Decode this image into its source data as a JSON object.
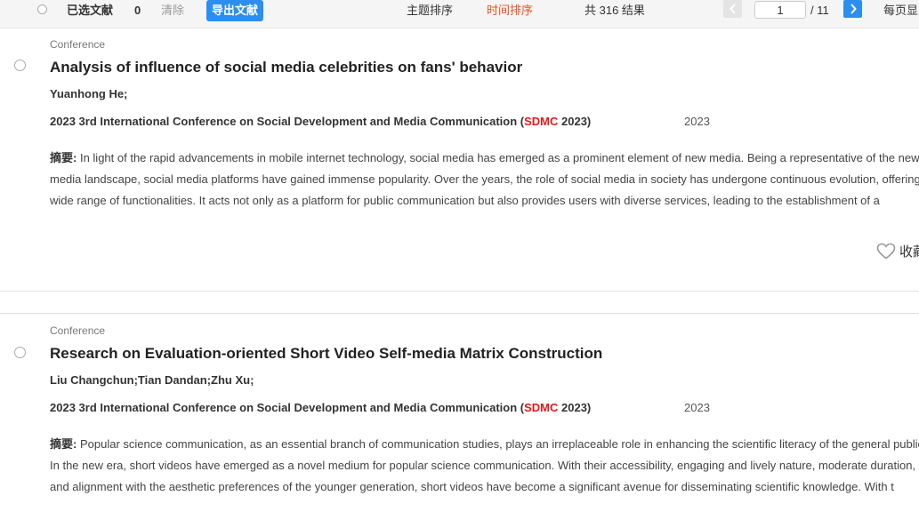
{
  "toolbar": {
    "selected_label": "已选文献",
    "selected_count": "0",
    "clear_label": "清除",
    "export_label": "导出文献",
    "sort_topic": "主题排序",
    "sort_time": "时间排序",
    "result_count": "共 316 结果",
    "page_current": "1",
    "page_total": "/ 11",
    "per_page_label": "每页显"
  },
  "results": [
    {
      "type": "Conference",
      "title": "Analysis of influence of social media celebrities on fans' behavior",
      "authors": "Yuanhong He;",
      "source_before": "2023 3rd International Conference on Social Development and Media Communication (",
      "source_highlight": "SDMC",
      "source_after": " 2023)",
      "year": "2023",
      "abstract_label": "摘要:",
      "abstract": "In light of the rapid advancements in mobile internet technology, social media has emerged as a prominent element of new media. Being a representative of the new media landscape, social media platforms have gained immense popularity. Over the years, the role of social media in society has undergone continuous evolution, offering a wide range of functionalities. It acts not only as a platform for public communication but also provides users with diverse services, leading to the establishment of a",
      "favorite_label": "收藏"
    },
    {
      "type": "Conference",
      "title": "Research on Evaluation-oriented Short Video Self-media Matrix Construction",
      "authors": "Liu Changchun;Tian Dandan;Zhu Xu;",
      "source_before": "2023 3rd International Conference on Social Development and Media Communication (",
      "source_highlight": "SDMC",
      "source_after": " 2023)",
      "year": "2023",
      "abstract_label": "摘要:",
      "abstract": "Popular science communication, as an essential branch of communication studies, plays an irreplaceable role in enhancing the scientific literacy of the general public. In the new era, short videos have emerged as a novel medium for popular science communication. With their accessibility, engaging and lively nature, moderate duration, and alignment with the aesthetic preferences of the younger generation, short videos have become a significant avenue for disseminating scientific knowledge. With t"
    }
  ],
  "colors": {
    "accent": "#2b8ef0",
    "active_sort": "#e6501e",
    "highlight": "#e21b1b"
  }
}
